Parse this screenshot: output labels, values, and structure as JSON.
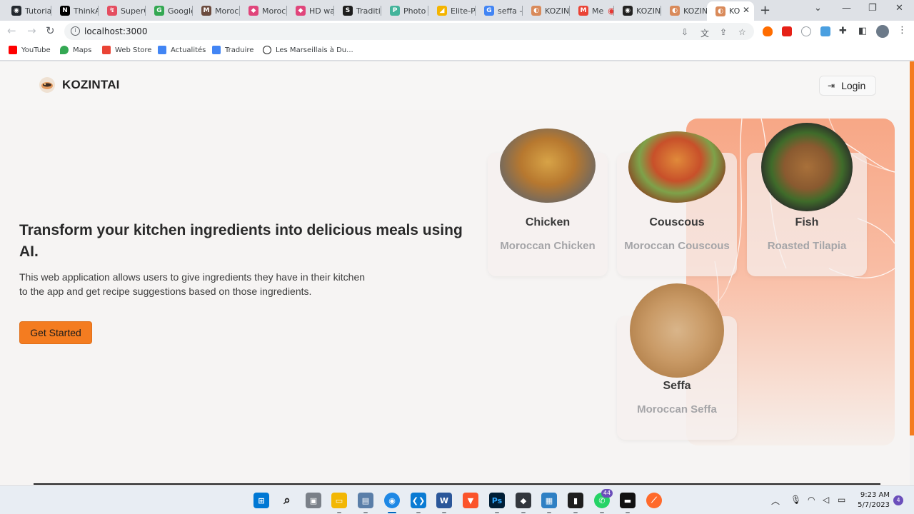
{
  "browser": {
    "tabs": [
      {
        "label": "Tutoria",
        "color": "#24292f",
        "glyph": "◉"
      },
      {
        "label": "ThinkA",
        "color": "#000000",
        "glyph": "N"
      },
      {
        "label": "SuperC",
        "color": "#e44d60",
        "glyph": "↯"
      },
      {
        "label": "Google",
        "color": "#34a853",
        "glyph": "G"
      },
      {
        "label": "Morocc",
        "color": "#6b4b3e",
        "glyph": "M"
      },
      {
        "label": "Morocc",
        "color": "#e0457b",
        "glyph": "◆"
      },
      {
        "label": "HD wal",
        "color": "#e0457b",
        "glyph": "◆"
      },
      {
        "label": "Traditio",
        "color": "#1d1d1d",
        "glyph": "S"
      },
      {
        "label": "Photo c",
        "color": "#43b49b",
        "glyph": "P"
      },
      {
        "label": "Elite-Pr",
        "color": "#f4b400",
        "glyph": "◢"
      },
      {
        "label": "seffa –",
        "color": "#4285f4",
        "glyph": "G"
      },
      {
        "label": "KOZINT",
        "color": "#d98a5a",
        "glyph": "◐"
      },
      {
        "label": "Me",
        "color": "#ea4335",
        "glyph": "M"
      },
      {
        "label": "KOZINT",
        "color": "#222222",
        "glyph": "◉"
      },
      {
        "label": "KOZINT",
        "color": "#d98a5a",
        "glyph": "◐"
      },
      {
        "label": "KO",
        "color": "#d98a5a",
        "glyph": "◐",
        "active": true
      }
    ],
    "new_tab_label": "+",
    "url": "localhost:3000",
    "bookmarks": [
      {
        "label": "YouTube",
        "color": "#ff0000"
      },
      {
        "label": "Maps",
        "color": "#34a853"
      },
      {
        "label": "Web Store",
        "color": "#ea4335"
      },
      {
        "label": "Actualités",
        "color": "#4285f4"
      },
      {
        "label": "Traduire",
        "color": "#4285f4"
      },
      {
        "label": "Les Marseillais à Du...",
        "color": "#222222"
      }
    ]
  },
  "navbar": {
    "brand": "KOZINTAI",
    "login_label": "Login",
    "login_icon": "login-icon"
  },
  "hero": {
    "title": "Transform your kitchen ingredients into delicious meals using AI.",
    "description": "This web application allows users to give ingredients they have in their kitchen to the app and get recipe suggestions based on those ingredients.",
    "cta_label": "Get Started"
  },
  "recipes": [
    {
      "name": "Chicken",
      "dish": "Moroccan Chicken"
    },
    {
      "name": "Couscous",
      "dish": "Moroccan Couscous"
    },
    {
      "name": "Fish",
      "dish": "Roasted Tilapia"
    },
    {
      "name": "Seffa",
      "dish": "Moroccan Seffa"
    }
  ],
  "colors": {
    "accent": "#f47c20",
    "panel": "#f7a786",
    "text": "#2a2a2a",
    "muted": "#a5a5a8"
  },
  "taskbar": {
    "time": "9:23 AM",
    "date": "5/7/2023",
    "whatsapp_badge": "44",
    "notification_count": "4"
  }
}
